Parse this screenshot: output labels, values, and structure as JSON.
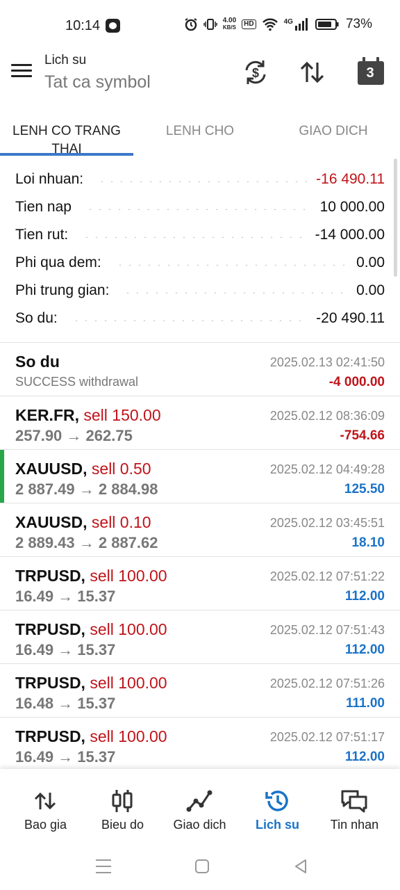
{
  "status_bar": {
    "time": "10:14",
    "net_speed_value": "4.00",
    "net_speed_unit": "KB/S",
    "hd_label": "HD",
    "network_label": "4G",
    "battery_text": "73%"
  },
  "header": {
    "title": "Lich su",
    "subtitle": "Tat ca symbol",
    "calendar_day": "3"
  },
  "tabs": [
    {
      "label": "LENH CO TRANG THAI",
      "active": true
    },
    {
      "label": "LENH CHO",
      "active": false
    },
    {
      "label": "GIAO DICH",
      "active": false
    }
  ],
  "summary": {
    "rows": [
      {
        "label": "Loi nhuan:",
        "value": "-16 490.11"
      },
      {
        "label": "Tien nap",
        "value": "10 000.00"
      },
      {
        "label": "Tien rut:",
        "value": "-14 000.00"
      },
      {
        "label": "Phi qua dem:",
        "value": "0.00"
      },
      {
        "label": "Phi trung gian:",
        "value": "0.00"
      },
      {
        "label": "So du:",
        "value": "-20 490.11"
      }
    ]
  },
  "colors": {
    "accent": "#1a73c8",
    "tab_underline": "#3b78c8",
    "negative": "#c0141a",
    "positive": "#1a73c8",
    "highlight_bar": "#2aa64a"
  },
  "balance_entry": {
    "title": "So du",
    "subtitle": "SUCCESS withdrawal",
    "time": "2025.02.13 02:41:50",
    "amount": "-4 000.00"
  },
  "trades": [
    {
      "symbol": "KER.FR,",
      "side": "sell 150.00",
      "prices": "257.90 → 262.75",
      "time": "2025.02.12 08:36:09",
      "profit": "-754.66"
    },
    {
      "symbol": "XAUUSD,",
      "side": "sell 0.50",
      "prices": "2 887.49 → 2 884.98",
      "time": "2025.02.12 04:49:28",
      "profit": "125.50"
    },
    {
      "symbol": "XAUUSD,",
      "side": "sell 0.10",
      "prices": "2 889.43 → 2 887.62",
      "time": "2025.02.12 03:45:51",
      "profit": "18.10"
    },
    {
      "symbol": "TRPUSD,",
      "side": "sell 100.00",
      "prices": "16.49 → 15.37",
      "time": "2025.02.12 07:51:22",
      "profit": "112.00"
    },
    {
      "symbol": "TRPUSD,",
      "side": "sell 100.00",
      "prices": "16.49 → 15.37",
      "time": "2025.02.12 07:51:43",
      "profit": "112.00"
    },
    {
      "symbol": "TRPUSD,",
      "side": "sell 100.00",
      "prices": "16.48 → 15.37",
      "time": "2025.02.12 07:51:26",
      "profit": "111.00"
    },
    {
      "symbol": "TRPUSD,",
      "side": "sell 100.00",
      "prices": "16.49 → 15.37",
      "time": "2025.02.12 07:51:17",
      "profit": "112.00"
    }
  ],
  "bottom_nav": [
    {
      "label": "Bao gia",
      "icon": "quotes-arrows-icon",
      "active": false
    },
    {
      "label": "Bieu do",
      "icon": "candlestick-chart-icon",
      "active": false
    },
    {
      "label": "Giao dich",
      "icon": "trade-line-icon",
      "active": false
    },
    {
      "label": "Lich su",
      "icon": "history-clock-icon",
      "active": true
    },
    {
      "label": "Tin nhan",
      "icon": "chat-messages-icon",
      "active": false
    }
  ]
}
